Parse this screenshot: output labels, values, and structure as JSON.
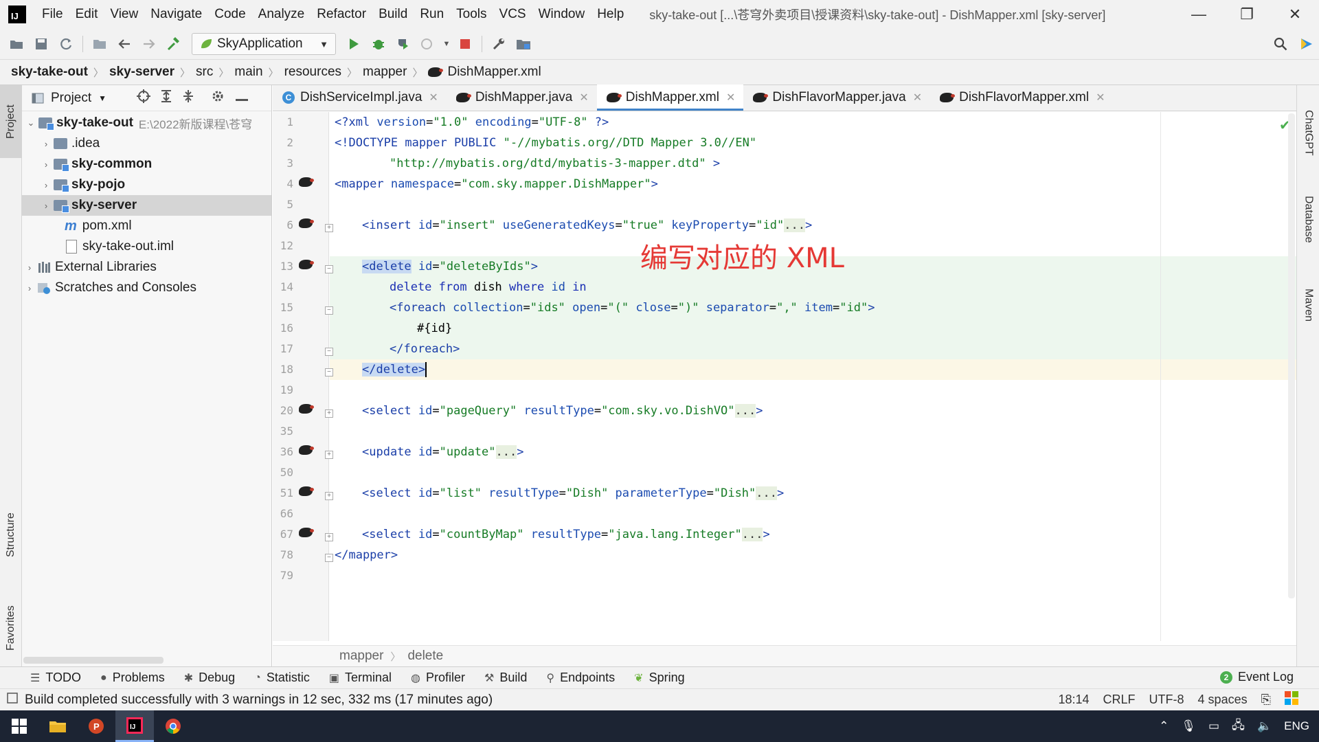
{
  "menu": {
    "items": [
      "File",
      "Edit",
      "View",
      "Navigate",
      "Code",
      "Analyze",
      "Refactor",
      "Build",
      "Run",
      "Tools",
      "VCS",
      "Window",
      "Help"
    ],
    "window_title": "sky-take-out [...\\苍穹外卖项目\\授课资料\\sky-take-out] - DishMapper.xml [sky-server]"
  },
  "window_controls": {
    "minimize": "—",
    "maximize": "❐",
    "close": "✕"
  },
  "toolbar": {
    "run_config": "SkyApplication"
  },
  "breadcrumb": [
    "sky-take-out",
    "sky-server",
    "src",
    "main",
    "resources",
    "mapper",
    "DishMapper.xml"
  ],
  "project": {
    "title": "Project",
    "tree": [
      {
        "label": "sky-take-out",
        "hint": "E:\\2022新版课程\\苍穹",
        "bold": true,
        "expanded": true
      },
      {
        "label": ".idea"
      },
      {
        "label": "sky-common",
        "bold": true
      },
      {
        "label": "sky-pojo",
        "bold": true
      },
      {
        "label": "sky-server",
        "bold": true
      },
      {
        "label": "pom.xml"
      },
      {
        "label": "sky-take-out.iml"
      },
      {
        "label": "External Libraries"
      },
      {
        "label": "Scratches and Consoles"
      }
    ]
  },
  "left_tools": {
    "project": "Project",
    "structure": "Structure",
    "favorites": "Favorites"
  },
  "right_tools": {
    "chatgpt": "ChatGPT",
    "database": "Database",
    "maven": "Maven"
  },
  "tabs": [
    "DishServiceImpl.java",
    "DishMapper.java",
    "DishMapper.xml",
    "DishFlavorMapper.java",
    "DishFlavorMapper.xml"
  ],
  "active_tab": "DishMapper.xml",
  "line_numbers": [
    "1",
    "2",
    "3",
    "4",
    "5",
    "6",
    "12",
    "13",
    "14",
    "15",
    "16",
    "17",
    "18",
    "19",
    "20",
    "35",
    "36",
    "50",
    "51",
    "66",
    "67",
    "78",
    "79"
  ],
  "code": {
    "l1": [
      "<?xml ",
      "version",
      "=",
      "\"1.0\"",
      " encoding",
      "=",
      "\"UTF-8\"",
      " ?>"
    ],
    "l2": [
      "<!DOCTYPE mapper PUBLIC ",
      "\"-//mybatis.org//DTD Mapper 3.0//EN\""
    ],
    "l3": [
      "\"http://mybatis.org/dtd/mybatis-3-mapper.dtd\"",
      " >"
    ],
    "l4": [
      "<mapper ",
      "namespace",
      "=",
      "\"com.sky.mapper.DishMapper\"",
      ">"
    ],
    "l6": [
      "<insert ",
      "id",
      "=",
      "\"insert\"",
      " useGeneratedKeys",
      "=",
      "\"true\"",
      " keyProperty",
      "=",
      "\"id\"",
      "...",
      ">"
    ],
    "l13": [
      "<delete",
      " id",
      "=",
      "\"deleteByIds\"",
      ">"
    ],
    "l14": [
      "delete",
      " from",
      " dish ",
      "where",
      " id ",
      "in"
    ],
    "l15": [
      "<foreach ",
      "collection",
      "=",
      "\"ids\"",
      " open",
      "=",
      "\"(\"",
      " close",
      "=",
      "\")\"",
      " separator",
      "=",
      "\",\"",
      " item",
      "=",
      "\"id\"",
      ">"
    ],
    "l16": [
      "#{id}"
    ],
    "l17": [
      "</foreach>"
    ],
    "l18": [
      "</delete",
      ">"
    ],
    "l20": [
      "<select ",
      "id",
      "=",
      "\"pageQuery\"",
      " resultType",
      "=",
      "\"com.sky.vo.DishVO\"",
      "...",
      ">"
    ],
    "l36": [
      "<update ",
      "id",
      "=",
      "\"update\"",
      "...",
      ">"
    ],
    "l51": [
      "<select ",
      "id",
      "=",
      "\"list\"",
      " resultType",
      "=",
      "\"Dish\"",
      " parameterType",
      "=",
      "\"Dish\"",
      "...",
      ">"
    ],
    "l67": [
      "<select ",
      "id",
      "=",
      "\"countByMap\"",
      " resultType",
      "=",
      "\"java.lang.Integer\"",
      "...",
      ">"
    ],
    "l78": [
      "</mapper>"
    ]
  },
  "annotation": "编写对应的 XML",
  "editor_breadcrumb": [
    "mapper",
    "delete"
  ],
  "bottom_tabs": [
    "TODO",
    "Problems",
    "Debug",
    "Statistic",
    "Terminal",
    "Profiler",
    "Build",
    "Endpoints",
    "Spring"
  ],
  "event_log": {
    "count": "2",
    "label": "Event Log"
  },
  "status": {
    "message": "Build completed successfully with 3 warnings in 12 sec, 332 ms (17 minutes ago)",
    "position": "18:14",
    "line_sep": "CRLF",
    "encoding": "UTF-8",
    "indent": "4 spaces"
  },
  "tray": {
    "lang": "ENG"
  }
}
